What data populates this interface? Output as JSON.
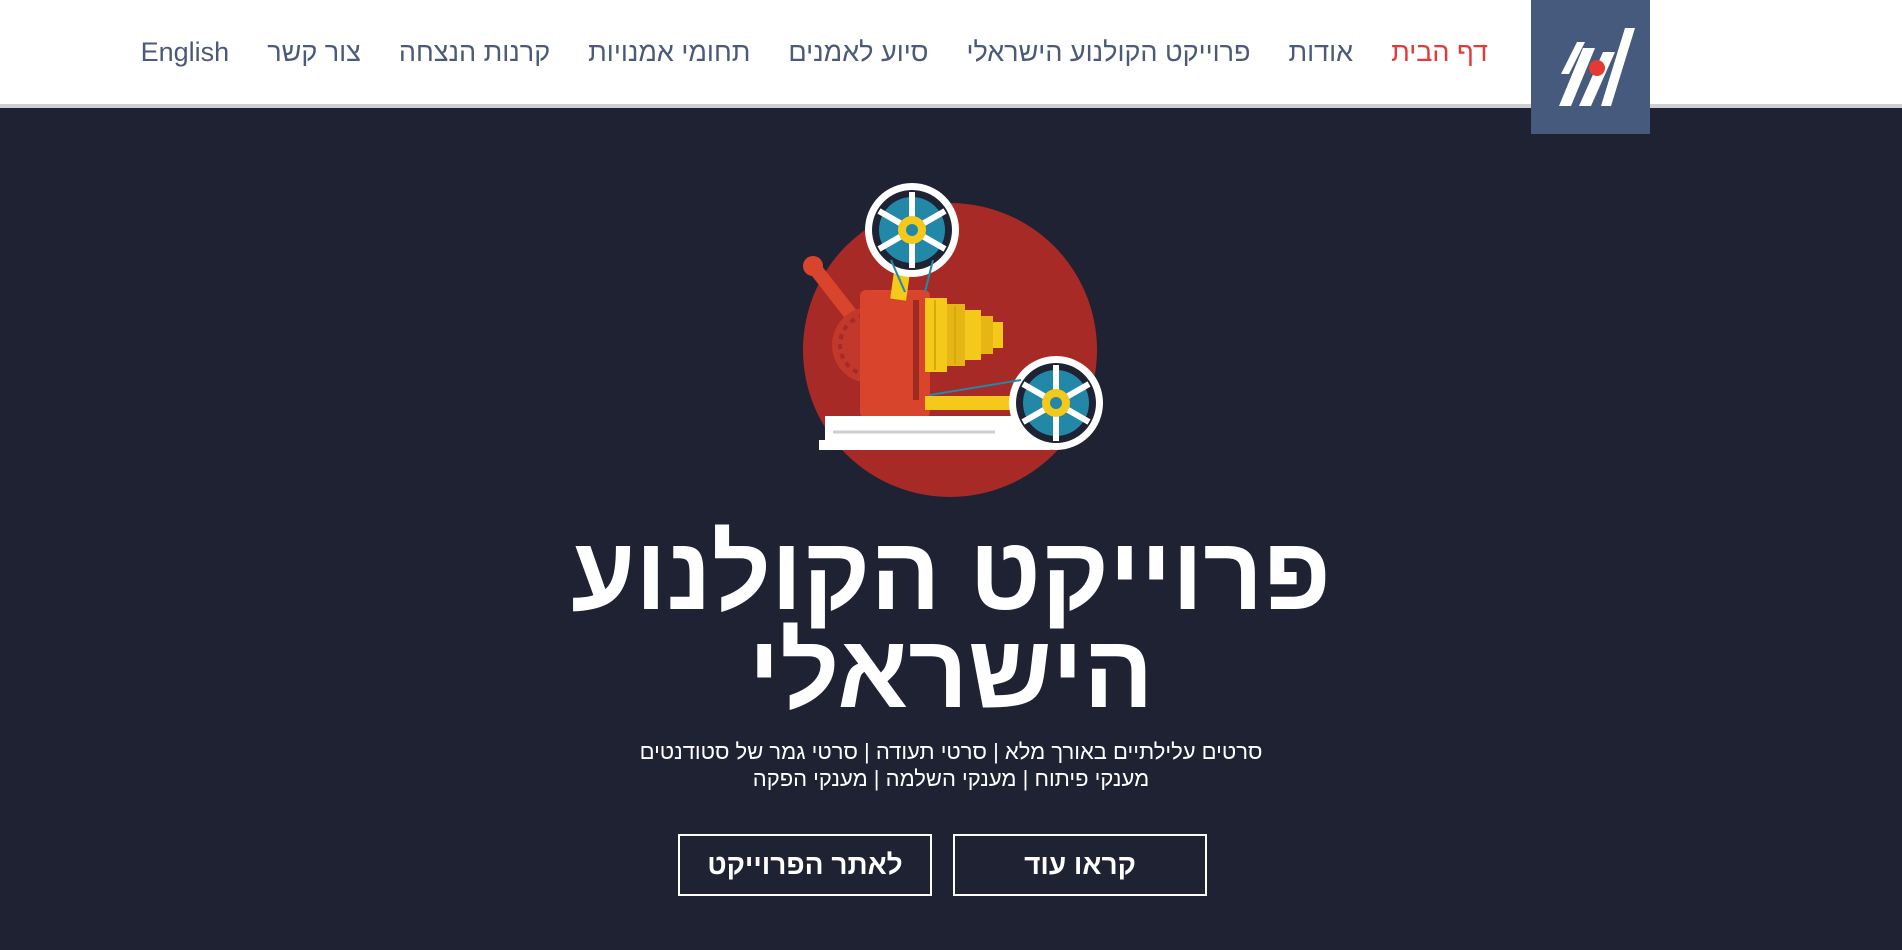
{
  "nav": {
    "items": [
      {
        "label": "דף הבית",
        "active": true
      },
      {
        "label": "אודות"
      },
      {
        "label": "פרוייקט הקולנוע הישראלי"
      },
      {
        "label": "סיוע לאמנים"
      },
      {
        "label": "תחומי אמנויות"
      },
      {
        "label": "קרנות הנצחה"
      },
      {
        "label": "צור קשר"
      },
      {
        "label": "English"
      }
    ]
  },
  "hero": {
    "title_line1": "פרוייקט הקולנוע",
    "title_line2": "הישראלי",
    "subtitle_line1": "סרטים עלילתיים באורך מלא | סרטי תעודה | סרטי גמר של סטודנטים",
    "subtitle_line2": "מענקי פיתוח | מענקי השלמה | מענקי הפקה"
  },
  "buttons": {
    "read_more": "קראו עוד",
    "project_site": "לאתר הפרוייקט"
  },
  "colors": {
    "background": "#1e2233",
    "logo_bg": "#465a7d",
    "nav_text": "#4a5a78",
    "nav_active": "#e53935",
    "circle_red": "#a82a27",
    "projector_body": "#d9442c",
    "reel_yellow": "#f4c91a",
    "reel_blue": "#2388a8"
  },
  "icons": {
    "logo": "site-logo",
    "hero": "film-projector-icon"
  }
}
